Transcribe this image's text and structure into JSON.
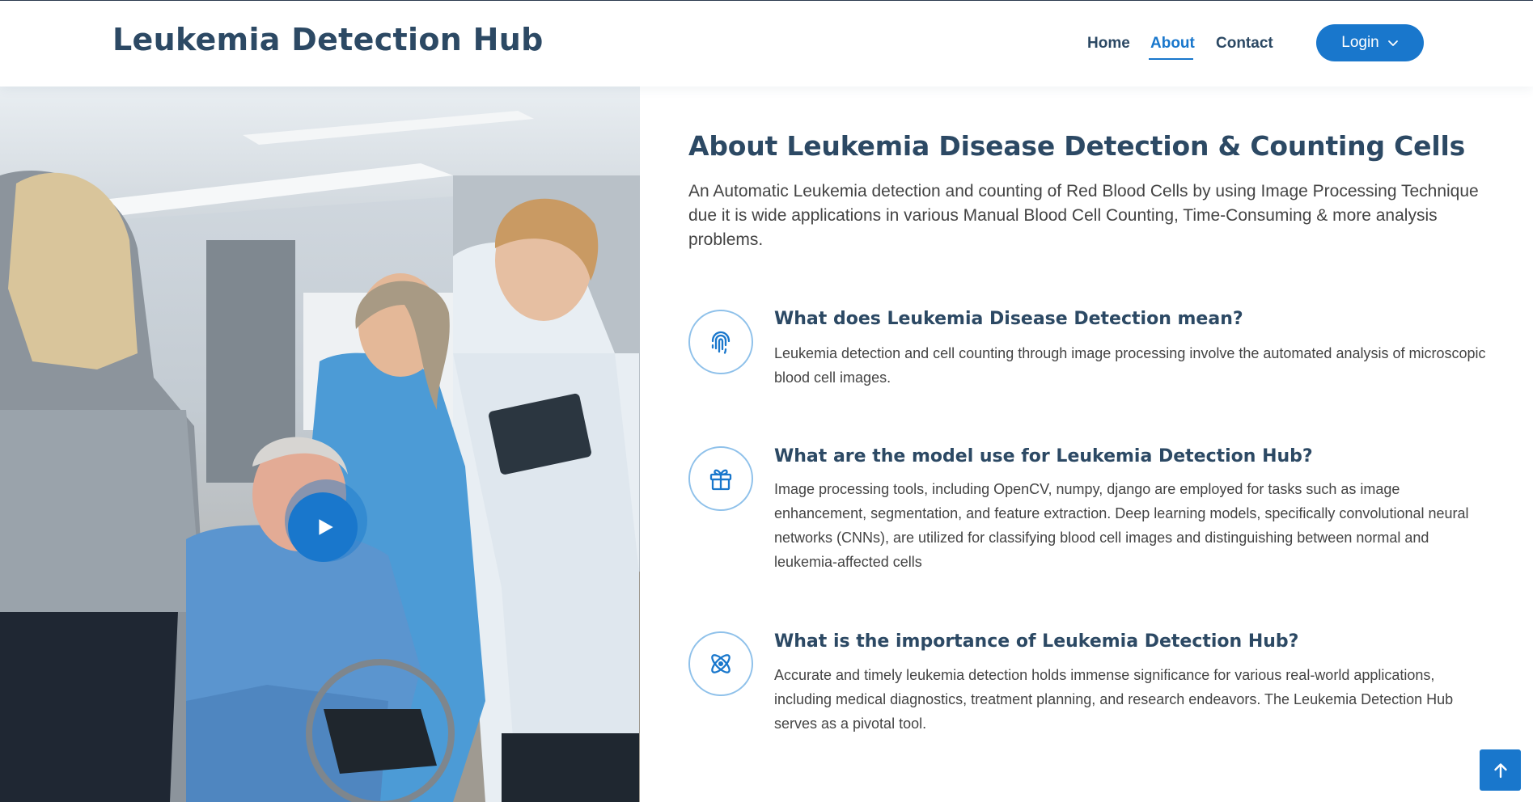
{
  "header": {
    "logo": "Leukemia Detection Hub",
    "nav": [
      {
        "label": "Home"
      },
      {
        "label": "About",
        "active": true
      },
      {
        "label": "Contact"
      }
    ],
    "login_label": "Login",
    "login_icon": "chevron-down-icon"
  },
  "hero_image": {
    "play_icon": "play-icon"
  },
  "about": {
    "title": "About Leukemia Disease Detection & Counting Cells",
    "intro": "An Automatic Leukemia detection and counting of Red Blood Cells by using Image Processing Technique due it is wide applications in various Manual Blood Cell Counting, Time-Consuming & more analysis problems.",
    "features": [
      {
        "icon": "fingerprint-icon",
        "title": "What does Leukemia Disease Detection mean?",
        "description": "Leukemia detection and cell counting through image processing involve the automated analysis of microscopic blood cell images."
      },
      {
        "icon": "gift-icon",
        "title": "What are the model use for Leukemia Detection Hub?",
        "description": "Image processing tools, including OpenCV, numpy, django are employed for tasks such as image enhancement, segmentation, and feature extraction. Deep learning models, specifically convolutional neural networks (CNNs), are utilized for classifying blood cell images and distinguishing between normal and leukemia-affected cells"
      },
      {
        "icon": "atom-icon",
        "title": "What is the importance of Leukemia Detection Hub?",
        "description": "Accurate and timely leukemia detection holds immense significance for various real-world applications, including medical diagnostics, treatment planning, and research endeavors. The Leukemia Detection Hub serves as a pivotal tool."
      }
    ]
  },
  "back_to_top_icon": "arrow-up-icon",
  "colors": {
    "primary": "#1977cc",
    "heading": "#2c4964",
    "body_text": "#444444",
    "icon_border": "#8fc1ea"
  }
}
